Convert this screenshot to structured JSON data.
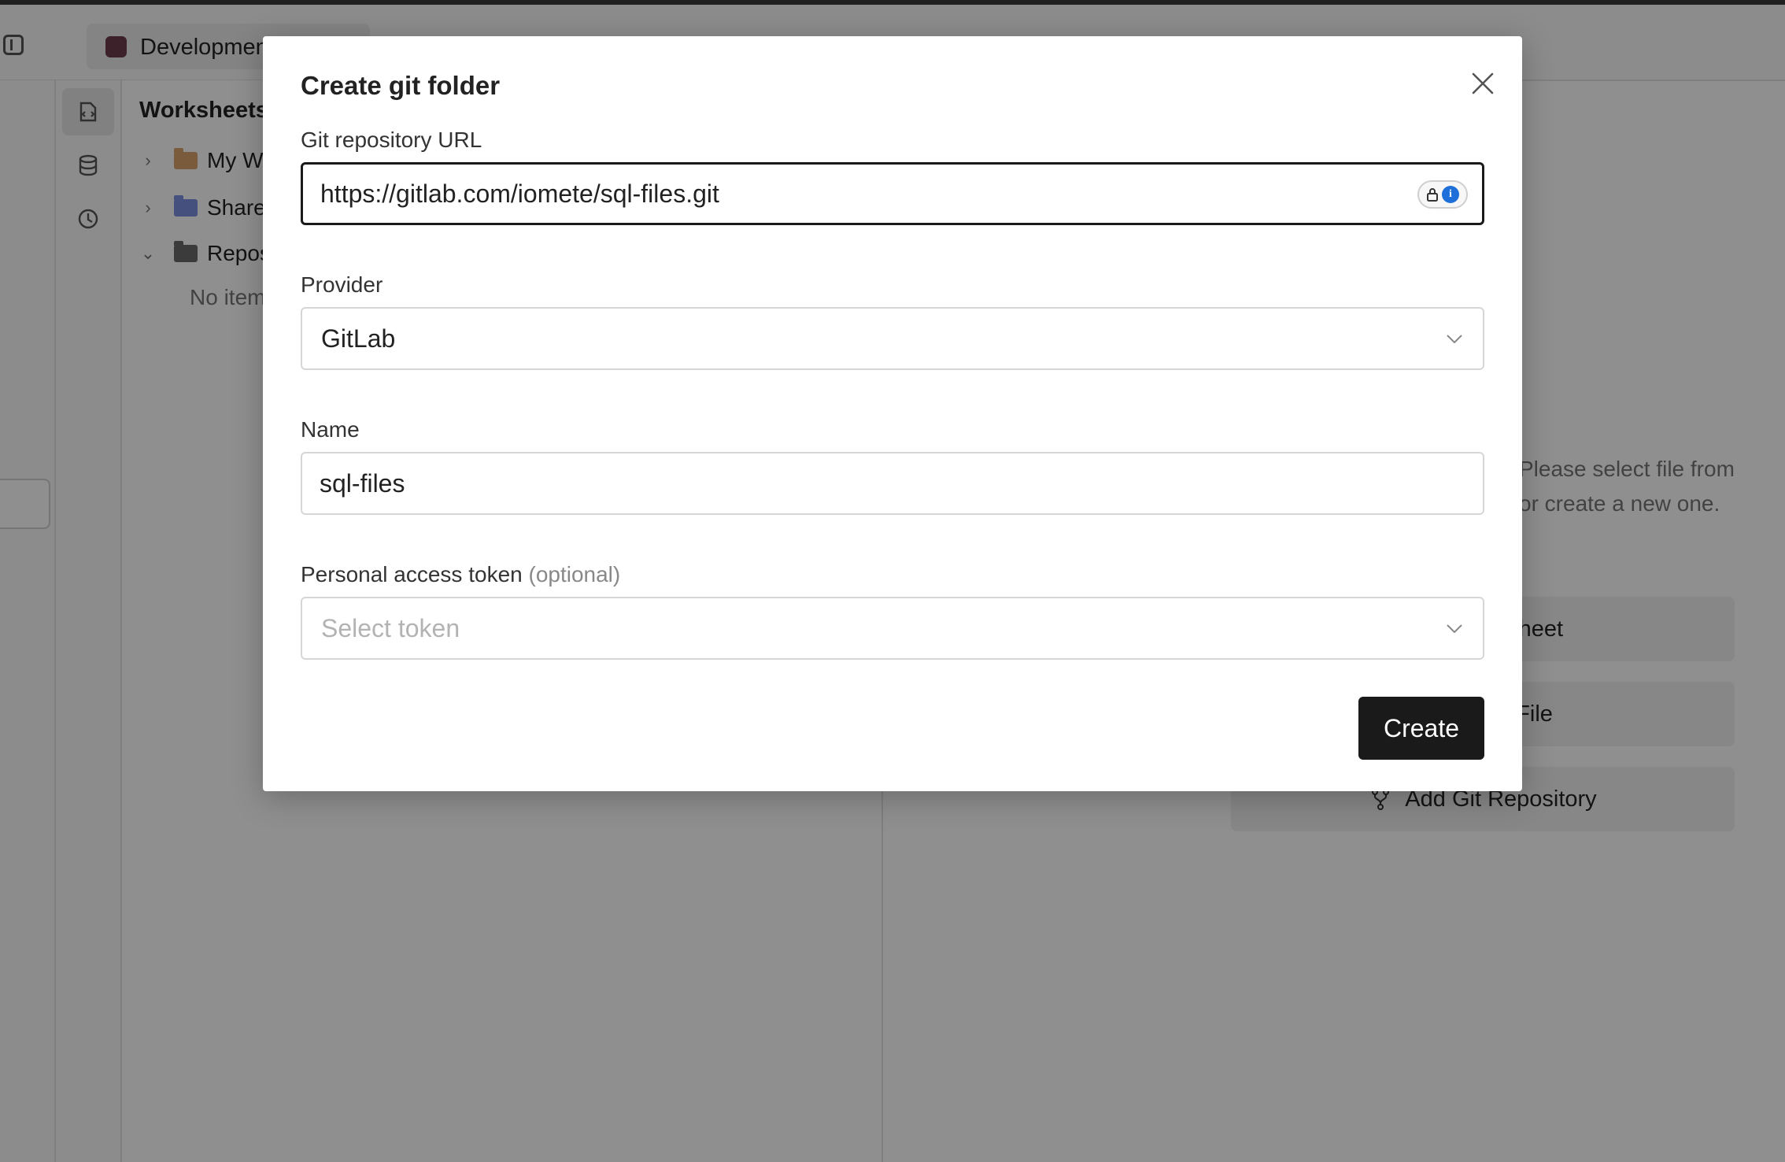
{
  "app": {
    "tab_label": "Development",
    "colors": {
      "modal_bg": "#ffffff",
      "primary_button": "#1a1a1a",
      "focus_border": "#1a1a1a",
      "overlay": "rgba(0,0,0,0.44)",
      "badge_blue": "#1e6fd9"
    }
  },
  "sidebar": {
    "rail_icons": [
      "worksheet-icon",
      "database-icon",
      "history-icon"
    ],
    "title": "Worksheets",
    "tree": [
      {
        "label": "My Worksheets",
        "expanded": false
      },
      {
        "label": "Shared",
        "expanded": false
      },
      {
        "label": "Repositories",
        "expanded": true
      }
    ],
    "empty_text": "No items"
  },
  "main": {
    "empty_line1": "Please select file from",
    "empty_line2": "or create a new one.",
    "actions": [
      {
        "label": "New Worksheet"
      },
      {
        "label": "New SQL File"
      },
      {
        "label": "Add Git Repository"
      }
    ]
  },
  "modal": {
    "title": "Create git folder",
    "url_label": "Git repository URL",
    "url_value": "https://gitlab.com/iomete/sql-files.git",
    "provider_label": "Provider",
    "provider_value": "GitLab",
    "name_label": "Name",
    "name_value": "sql-files",
    "token_label": "Personal access token",
    "token_optional": "(optional)",
    "token_placeholder": "Select token",
    "create_label": "Create"
  }
}
